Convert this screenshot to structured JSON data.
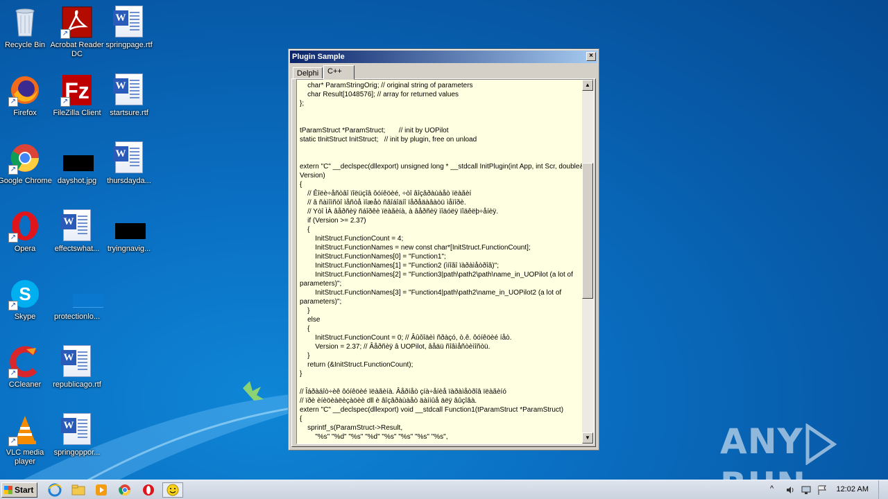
{
  "desktop_icons": [
    {
      "label": "Recycle Bin"
    },
    {
      "label": "Acrobat Reader DC"
    },
    {
      "label": "springpage.rtf"
    },
    {
      "label": "Firefox"
    },
    {
      "label": "FileZilla Client"
    },
    {
      "label": "startsure.rtf"
    },
    {
      "label": "Google Chrome"
    },
    {
      "label": "dayshot.jpg"
    },
    {
      "label": "thursdayda..."
    },
    {
      "label": "Opera"
    },
    {
      "label": "effectswhat..."
    },
    {
      "label": "tryingnavig..."
    },
    {
      "label": "Skype"
    },
    {
      "label": "protectionlo..."
    },
    {
      "label": "CCleaner"
    },
    {
      "label": "republicago.rtf"
    },
    {
      "label": "VLC media player"
    },
    {
      "label": "springoppor..."
    }
  ],
  "window": {
    "title": "Plugin Sample",
    "close_glyph": "×",
    "tabs": [
      {
        "label": "Delphi"
      },
      {
        "label": "C++"
      }
    ],
    "code_lines": [
      "    char* ParamStringOrig; // original string of parameters",
      "    char Result[1048576]; // array for returned values",
      "};",
      "",
      "",
      "tParamStruct *ParamStruct;       // init by UOPilot",
      "static tInitStruct InitStruct;   // init by plugin, free on unload",
      "",
      "",
      "extern \"C\" __declspec(dllexport) unsigned long * __stdcall InitPlugin(int App, int Scr, double& Version)",
      "{",
      "    // Êîëè÷åñòâî ïîëüçîâ ôóíêöèé, ÷òî âîçâðàùàåò ïëàãèí",
      "    // â ñàìîìñòî ìåñòå ìîæåò ñâîáîäíî ïåðåäàâàòü ìåìîðè.",
      "    // Yòî ÌÀ âåðñèÿ ñáîðêè ïëàãèíà, à âåðñèÿ ìîäóëÿ ïîäêëþ÷åíèÿ.",
      "    if (Version >= 2.37)",
      "    {",
      "        InitStruct.FunctionCount = 4;",
      "        InitStruct.FunctionNames = new const char*[InitStruct.FunctionCount];",
      "        InitStruct.FunctionNames[0] = \"Function1\";",
      "        InitStruct.FunctionNames[1] = \"Function2 (ìíîãî ïàðàìåòðîâ)\";",
      "        InitStruct.FunctionNames[2] = \"Function3|path\\path2\\path\\name_in_UOPilot (a lot of parameters)\";",
      "        InitStruct.FunctionNames[3] = \"Function4|path\\path2\\name_in_UOPilot2 (a lot of parameters)\";",
      "    }",
      "    else",
      "    {",
      "        InitStruct.FunctionCount = 0; // Âûõîäèì ñðàçó, ò.ê. ôóíêöèé íåò.",
      "        Version = 2.37; // Âåðñèÿ â UOPilot, âåäü ñîâìåñòèìîñòü.",
      "    }",
      "    return (&InitStruct.FunctionCount);",
      "}",
      "",
      "// Îáðàáîò÷èê ôóíêöèé ïëàãèíà. Âåðíåò çíà÷åíèå ïàðàìåòðîâ ïëàãèíó",
      "// ïðè èíèöèàëèçàöèè dll è âîçâðàùàåò äàííûå äëÿ âûçîâà.",
      "extern \"C\" __declspec(dllexport) void __stdcall Function1(tParamStruct *ParamStruct)",
      "{",
      "    sprintf_s(ParamStruct->Result,",
      "        \"%s\" \"%d\" \"%s\" \"%d\" \"%s\" \"%s\" \"%s\" \"%s\","
    ],
    "scroll_up_glyph": "▲",
    "scroll_down_glyph": "▼"
  },
  "watermark": {
    "left": "ANY",
    "right": "RUN"
  },
  "taskbar": {
    "start_label": "Start",
    "icons": [
      "ie-icon",
      "explorer-icon",
      "media-player-icon",
      "chrome-icon",
      "opera-icon",
      "smiley-icon"
    ],
    "tray_up_glyph": "^",
    "clock": "12:02 AM"
  }
}
